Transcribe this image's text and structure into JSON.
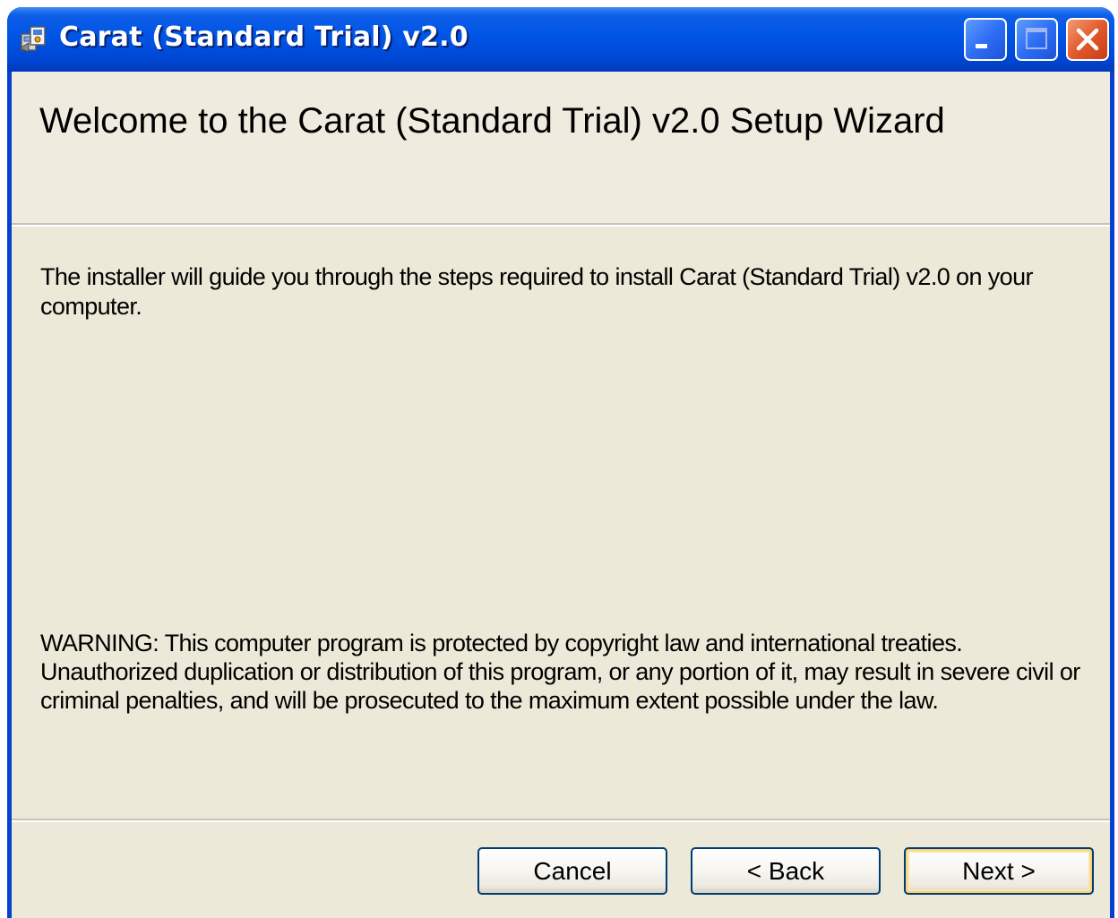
{
  "window": {
    "title": "Carat (Standard Trial) v2.0"
  },
  "titlebar_buttons": {
    "minimize": "minimize-icon",
    "maximize": "maximize-icon",
    "close": "close-icon"
  },
  "header": {
    "heading": "Welcome to the Carat (Standard Trial) v2.0 Setup Wizard"
  },
  "body": {
    "intro": "The installer will guide you through the steps required to install Carat (Standard Trial) v2.0 on your computer.",
    "warning": "WARNING: This computer program is protected by copyright law and international treaties. Unauthorized duplication or distribution of this program, or any portion of it, may result in severe civil or criminal penalties, and will be prosecuted to the maximum extent possible under the law."
  },
  "buttons": {
    "cancel": "Cancel",
    "back": "< Back",
    "next": "Next >"
  },
  "colors": {
    "titlebar": "#0055e5",
    "client_bg": "#ece9d8",
    "close_button": "#e35a2d"
  }
}
